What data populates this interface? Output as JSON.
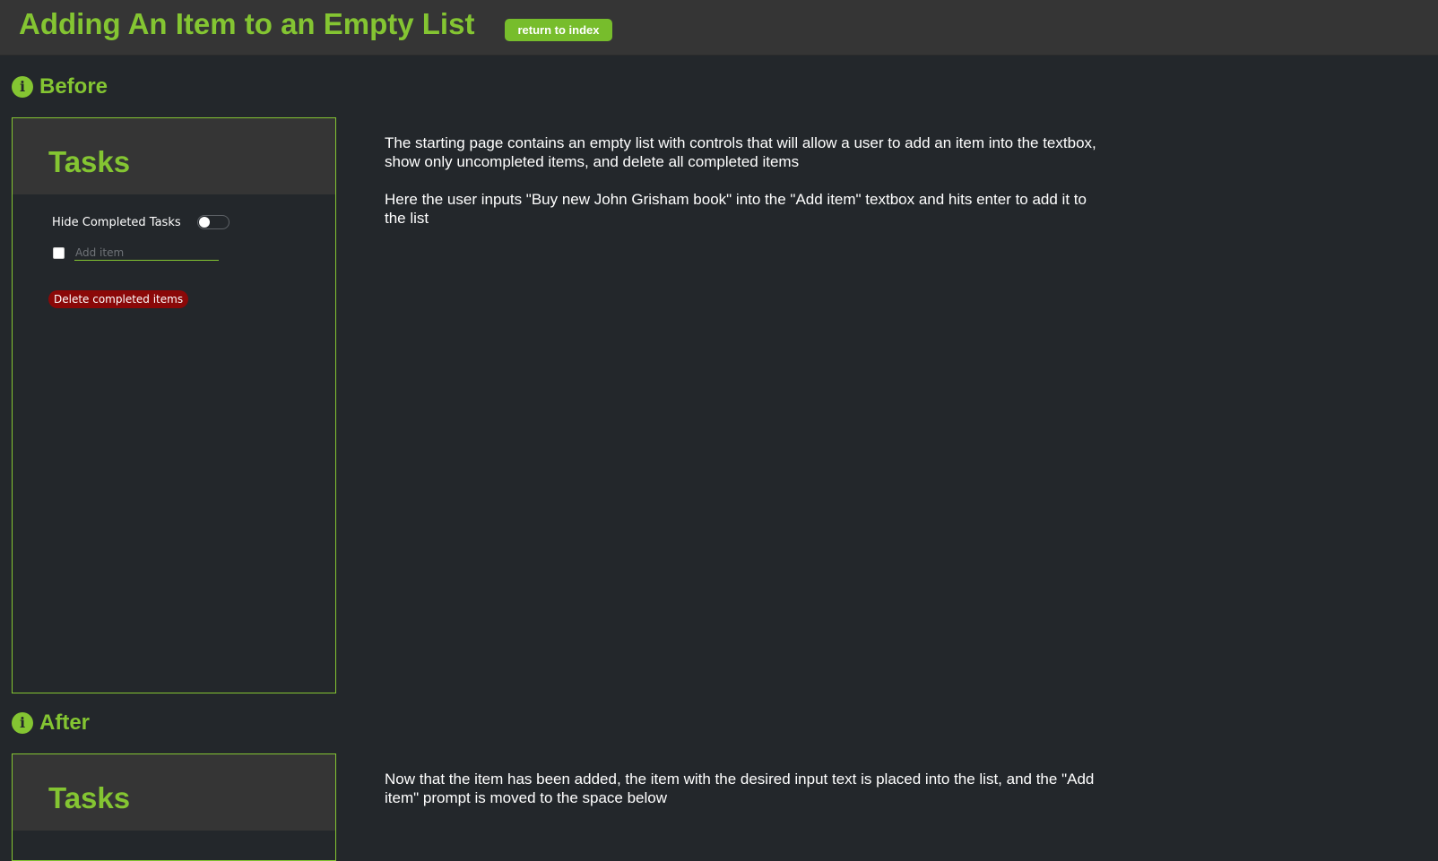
{
  "header": {
    "title": "Adding An Item to an Empty List",
    "return_label": "return to index"
  },
  "sections": [
    {
      "heading": "Before",
      "panel": {
        "title": "Tasks",
        "hide_completed_label": "Hide Completed Tasks",
        "hide_completed_on": false,
        "add_item_placeholder": "Add item",
        "add_item_value": "",
        "delete_label": "Delete completed items"
      },
      "description": [
        "The starting page contains an empty list with controls that will allow a user to add an item into the textbox, show only uncompleted items, and delete all completed items",
        "Here the user inputs \"Buy new John Grisham book\" into the \"Add item\" textbox and hits enter to add it to the list"
      ]
    },
    {
      "heading": "After",
      "panel": {
        "title": "Tasks"
      },
      "description": [
        "Now that the item has been added, the item with the desired input text is placed into the list, and the \"Add item\" prompt is moved to the space below"
      ]
    }
  ],
  "colors": {
    "accent": "#84c532",
    "danger": "#8a0808",
    "background": "#23272b",
    "panel_header": "#353535"
  },
  "icons": {
    "section": "info-icon"
  }
}
